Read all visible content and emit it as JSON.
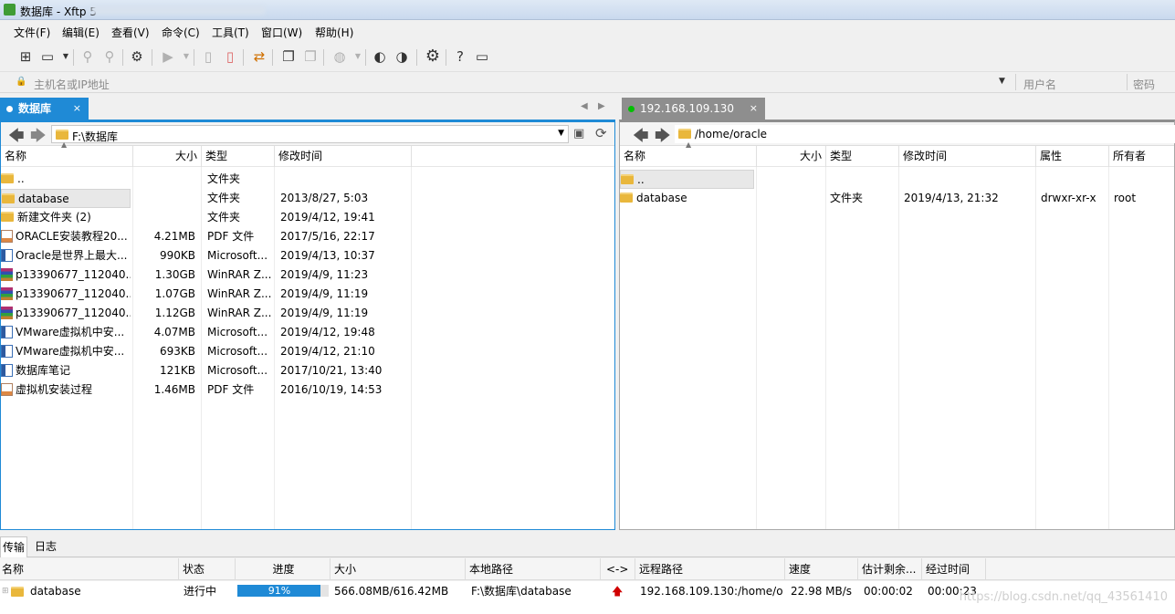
{
  "window": {
    "title": "数据库 - Xftp 5"
  },
  "menu": [
    "文件(F)",
    "编辑(E)",
    "查看(V)",
    "命令(C)",
    "工具(T)",
    "窗口(W)",
    "帮助(H)"
  ],
  "address": {
    "host_placeholder": "主机名或IP地址",
    "user_placeholder": "用户名",
    "password_placeholder": "密码"
  },
  "left": {
    "tab_label": "数据库",
    "path": "F:\\数据库",
    "columns": {
      "name": "名称",
      "size": "大小",
      "type": "类型",
      "modified": "修改时间"
    },
    "files": [
      {
        "name": "..",
        "size": "",
        "type": "文件夹",
        "modified": "",
        "icon": "folder"
      },
      {
        "name": "database",
        "size": "",
        "type": "文件夹",
        "modified": "2013/8/27, 5:03",
        "icon": "folder"
      },
      {
        "name": "新建文件夹 (2)",
        "size": "",
        "type": "文件夹",
        "modified": "2019/4/12, 19:41",
        "icon": "folder"
      },
      {
        "name": "ORACLE安装教程20...",
        "size": "4.21MB",
        "type": "PDF 文件",
        "modified": "2017/5/16, 22:17",
        "icon": "pdf"
      },
      {
        "name": "Oracle是世界上最大...",
        "size": "990KB",
        "type": "Microsoft...",
        "modified": "2019/4/13, 10:37",
        "icon": "doc"
      },
      {
        "name": "p13390677_112040...",
        "size": "1.30GB",
        "type": "WinRAR Z...",
        "modified": "2019/4/9, 11:23",
        "icon": "rar"
      },
      {
        "name": "p13390677_112040...",
        "size": "1.07GB",
        "type": "WinRAR Z...",
        "modified": "2019/4/9, 11:19",
        "icon": "rar"
      },
      {
        "name": "p13390677_112040...",
        "size": "1.12GB",
        "type": "WinRAR Z...",
        "modified": "2019/4/9, 11:19",
        "icon": "rar"
      },
      {
        "name": "VMware虚拟机中安...",
        "size": "4.07MB",
        "type": "Microsoft...",
        "modified": "2019/4/12, 19:48",
        "icon": "doc"
      },
      {
        "name": "VMware虚拟机中安...",
        "size": "693KB",
        "type": "Microsoft...",
        "modified": "2019/4/12, 21:10",
        "icon": "doc"
      },
      {
        "name": "数据库笔记",
        "size": "121KB",
        "type": "Microsoft...",
        "modified": "2017/10/21, 13:40",
        "icon": "doc"
      },
      {
        "name": "虚拟机安装过程",
        "size": "1.46MB",
        "type": "PDF 文件",
        "modified": "2016/10/19, 14:53",
        "icon": "pdf"
      }
    ]
  },
  "right": {
    "tab_label": "192.168.109.130",
    "path": "/home/oracle",
    "columns": {
      "name": "名称",
      "size": "大小",
      "type": "类型",
      "modified": "修改时间",
      "attr": "属性",
      "owner": "所有者"
    },
    "files": [
      {
        "name": "..",
        "size": "",
        "type": "",
        "modified": "",
        "attr": "",
        "owner": "",
        "icon": "folder"
      },
      {
        "name": "database",
        "size": "",
        "type": "文件夹",
        "modified": "2019/4/13, 21:32",
        "attr": "drwxr-xr-x",
        "owner": "root",
        "icon": "folder"
      }
    ]
  },
  "transfer": {
    "tabs": [
      "传输",
      "日志"
    ],
    "columns": {
      "name": "名称",
      "status": "状态",
      "progress": "进度",
      "size": "大小",
      "local": "本地路径",
      "dir": "<->",
      "remote": "远程路径",
      "speed": "速度",
      "eta": "估计剩余...",
      "elapsed": "经过时间"
    },
    "row": {
      "name": "database",
      "status": "进行中",
      "progress_label": "91%",
      "progress": 0.91,
      "size": "566.08MB/616.42MB",
      "local": "F:\\数据库\\database",
      "remote": "192.168.109.130:/home/o...",
      "speed": "22.98 MB/s",
      "eta": "00:00:02",
      "elapsed": "00:00:23"
    }
  },
  "watermark": "https://blog.csdn.net/qq_43561410"
}
